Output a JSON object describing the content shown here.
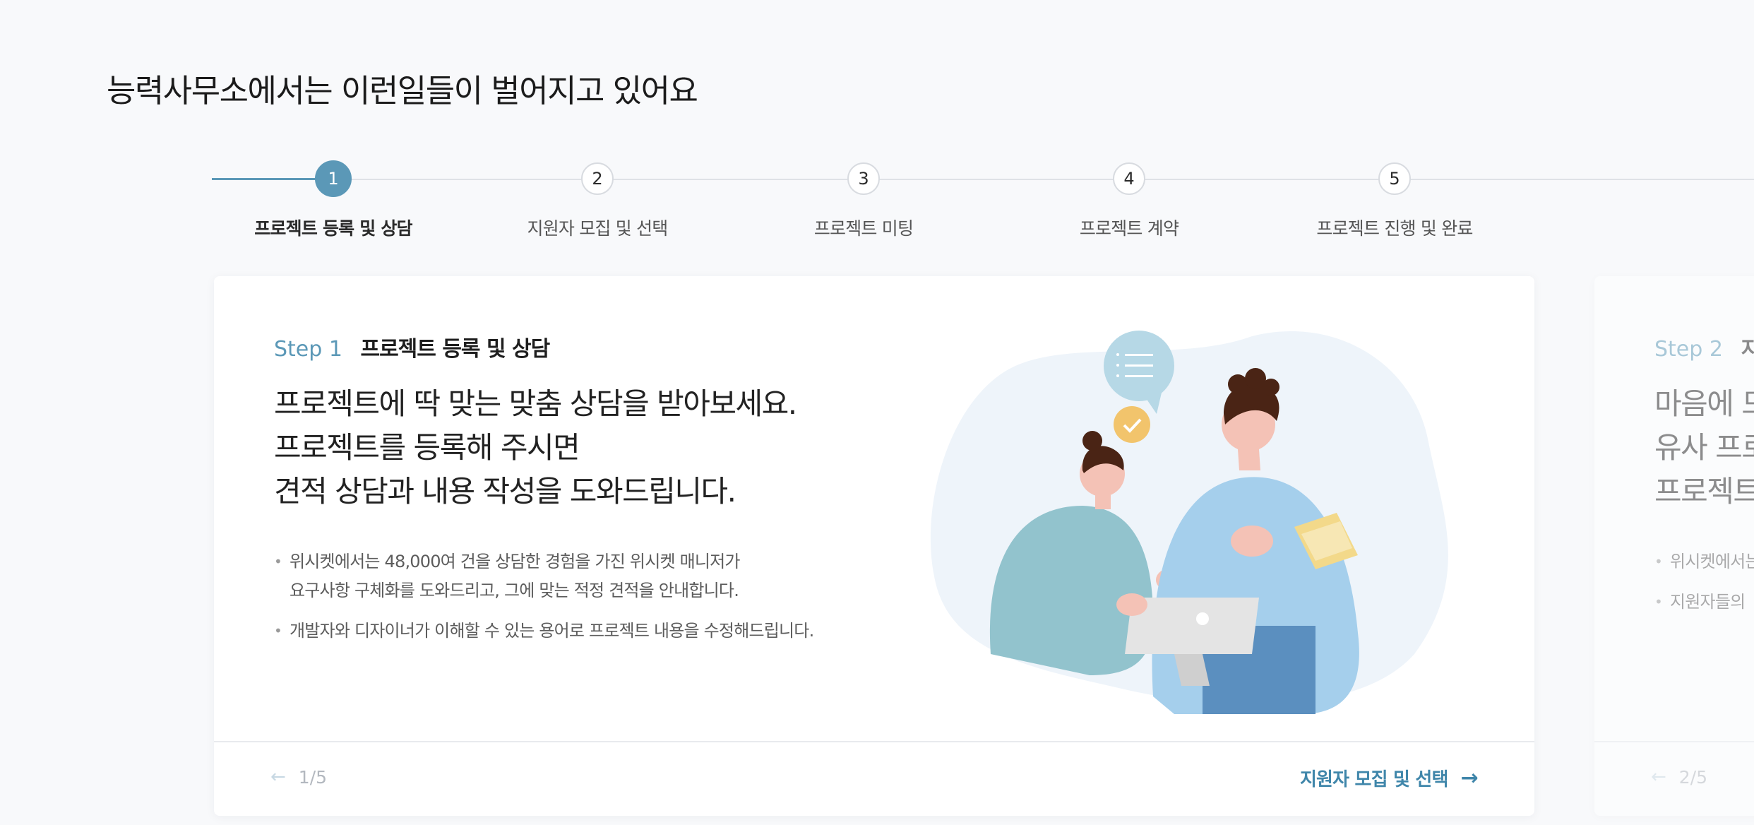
{
  "page": {
    "title": "능력사무소에서는 이런일들이 벌어지고 있어요"
  },
  "stepper": {
    "steps": [
      {
        "number": "1",
        "label": "프로젝트 등록 및 상담"
      },
      {
        "number": "2",
        "label": "지원자 모집 및 선택"
      },
      {
        "number": "3",
        "label": "프로젝트 미팅"
      },
      {
        "number": "4",
        "label": "프로젝트 계약"
      },
      {
        "number": "5",
        "label": "프로젝트 진행 및 완료"
      }
    ],
    "active_step": 1
  },
  "card": {
    "step_no": "Step 1",
    "step_name": "프로젝트 등록 및 상담",
    "headline": [
      "프로젝트에 딱 맞는 맞춤 상담을 받아보세요.",
      "프로젝트를 등록해 주시면",
      "견적 상담과 내용 작성을 도와드립니다."
    ],
    "bullets": [
      "위시켓에서는 48,000여 건을 상담한 경험을 가진 위시켓 매니저가\n요구사항 구체화를 도와드리고, 그에 맞는 적정 견적을 안내합니다.",
      "개발자와 디자이너가 이해할 수 있는 용어로 프로젝트 내용을 수정해드립니다."
    ],
    "pager": "1/5",
    "next_label": "지원자 모집 및 선택"
  },
  "next_card": {
    "step_no": "Step 2",
    "step_name": "지원",
    "headline": [
      "마음에 드",
      "유사 프로",
      "프로젝트"
    ],
    "bullets": [
      "위시켓에서는",
      "지원자들의"
    ],
    "pager": "2/5"
  },
  "colors": {
    "accent": "#5b98b7",
    "link": "#3f86aa",
    "track": "#dfe2e6"
  }
}
